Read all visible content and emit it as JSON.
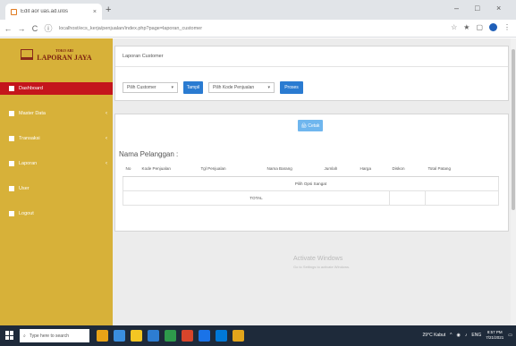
{
  "browser": {
    "tab_title": "Edit aor uas.ad.ulos",
    "tab_close": "×",
    "new_tab": "+",
    "window_controls": [
      "–",
      "□",
      "×"
    ],
    "url": "localhost/ecs_kerja/penjualan/index.php?page=laporan_customer",
    "nav": [
      "←",
      "→",
      "C",
      "ⓘ"
    ]
  },
  "sidebar": {
    "logo_text": "TOKO ABI",
    "logo_sub": "LAPORAN JAYA",
    "items": [
      {
        "label": "Dashboard",
        "active": true,
        "has_chevron": false
      },
      {
        "label": "Master Data",
        "active": false,
        "has_chevron": true
      },
      {
        "label": "Transaksi",
        "active": false,
        "has_chevron": true
      },
      {
        "label": "Laporan",
        "active": false,
        "has_chevron": true
      },
      {
        "label": "User",
        "active": false,
        "has_chevron": false
      },
      {
        "label": "Logout",
        "active": false,
        "has_chevron": false
      }
    ]
  },
  "report": {
    "panel_title": "Laporan Customer",
    "select_customer": "Pilih Customer",
    "btn_tampil": "Tampil",
    "select_kode": "Pilih Kode Penjualan",
    "btn_proses": "Proses",
    "btn_cetak": "🖨 Cetak",
    "nama_pelanggan_label": "Nama Pelanggan :",
    "columns": [
      "No",
      "Kode Penjualan",
      "Tgl Penjualan",
      "Nama Barang",
      "Jumlah",
      "Harga",
      "Diskon",
      "Total Patang"
    ],
    "empty_message": "Pilih Opsi Sangat",
    "total_label": "TOTAL"
  },
  "watermark": {
    "title": "Activate Windows",
    "sub": "Go to Settings to activate Windows."
  },
  "taskbar": {
    "search_placeholder": "Type here to search",
    "weather": "29°C Kabut",
    "lang": "ENG",
    "time": "8:57 PM",
    "date": "7/21/2021",
    "icon_colors": [
      "#e8a317",
      "#3a8fe0",
      "#f3c623",
      "#2d7dd2",
      "#2e9a4b",
      "#d8452b",
      "#1a73e8",
      "#0078d7",
      "#e3a51b"
    ]
  }
}
